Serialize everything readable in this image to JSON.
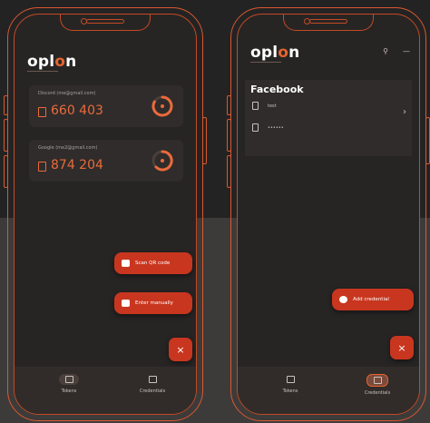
{
  "colors": {
    "accent": "#e5632e",
    "fab": "#c9361f",
    "background": "#242323"
  },
  "left_phone": {
    "logo": {
      "prefix": "opl",
      "highlight": "o",
      "suffix": "n"
    },
    "tokens": [
      {
        "account": "Discord (me@gmail.com)",
        "code": "660 403"
      },
      {
        "account": "Google (me2@gmail.com)",
        "code": "874 204"
      }
    ],
    "fab": {
      "scan_label": "Scan QR code",
      "manual_label": "Enter manually",
      "close_label": "×"
    },
    "nav": {
      "tokens_label": "Tokens",
      "credentials_label": "Credentials"
    }
  },
  "right_phone": {
    "logo": {
      "prefix": "opl",
      "highlight": "o",
      "suffix": "n"
    },
    "top_icons": {
      "search": "⚲",
      "menu": "—"
    },
    "section_title": "Facebook",
    "rows": [
      {
        "value": "test"
      },
      {
        "value": "••••••"
      }
    ],
    "chevron": "›",
    "fab": {
      "add_label": "Add credential",
      "close_label": "×"
    },
    "nav": {
      "tokens_label": "Tokens",
      "credentials_label": "Credentials"
    }
  }
}
